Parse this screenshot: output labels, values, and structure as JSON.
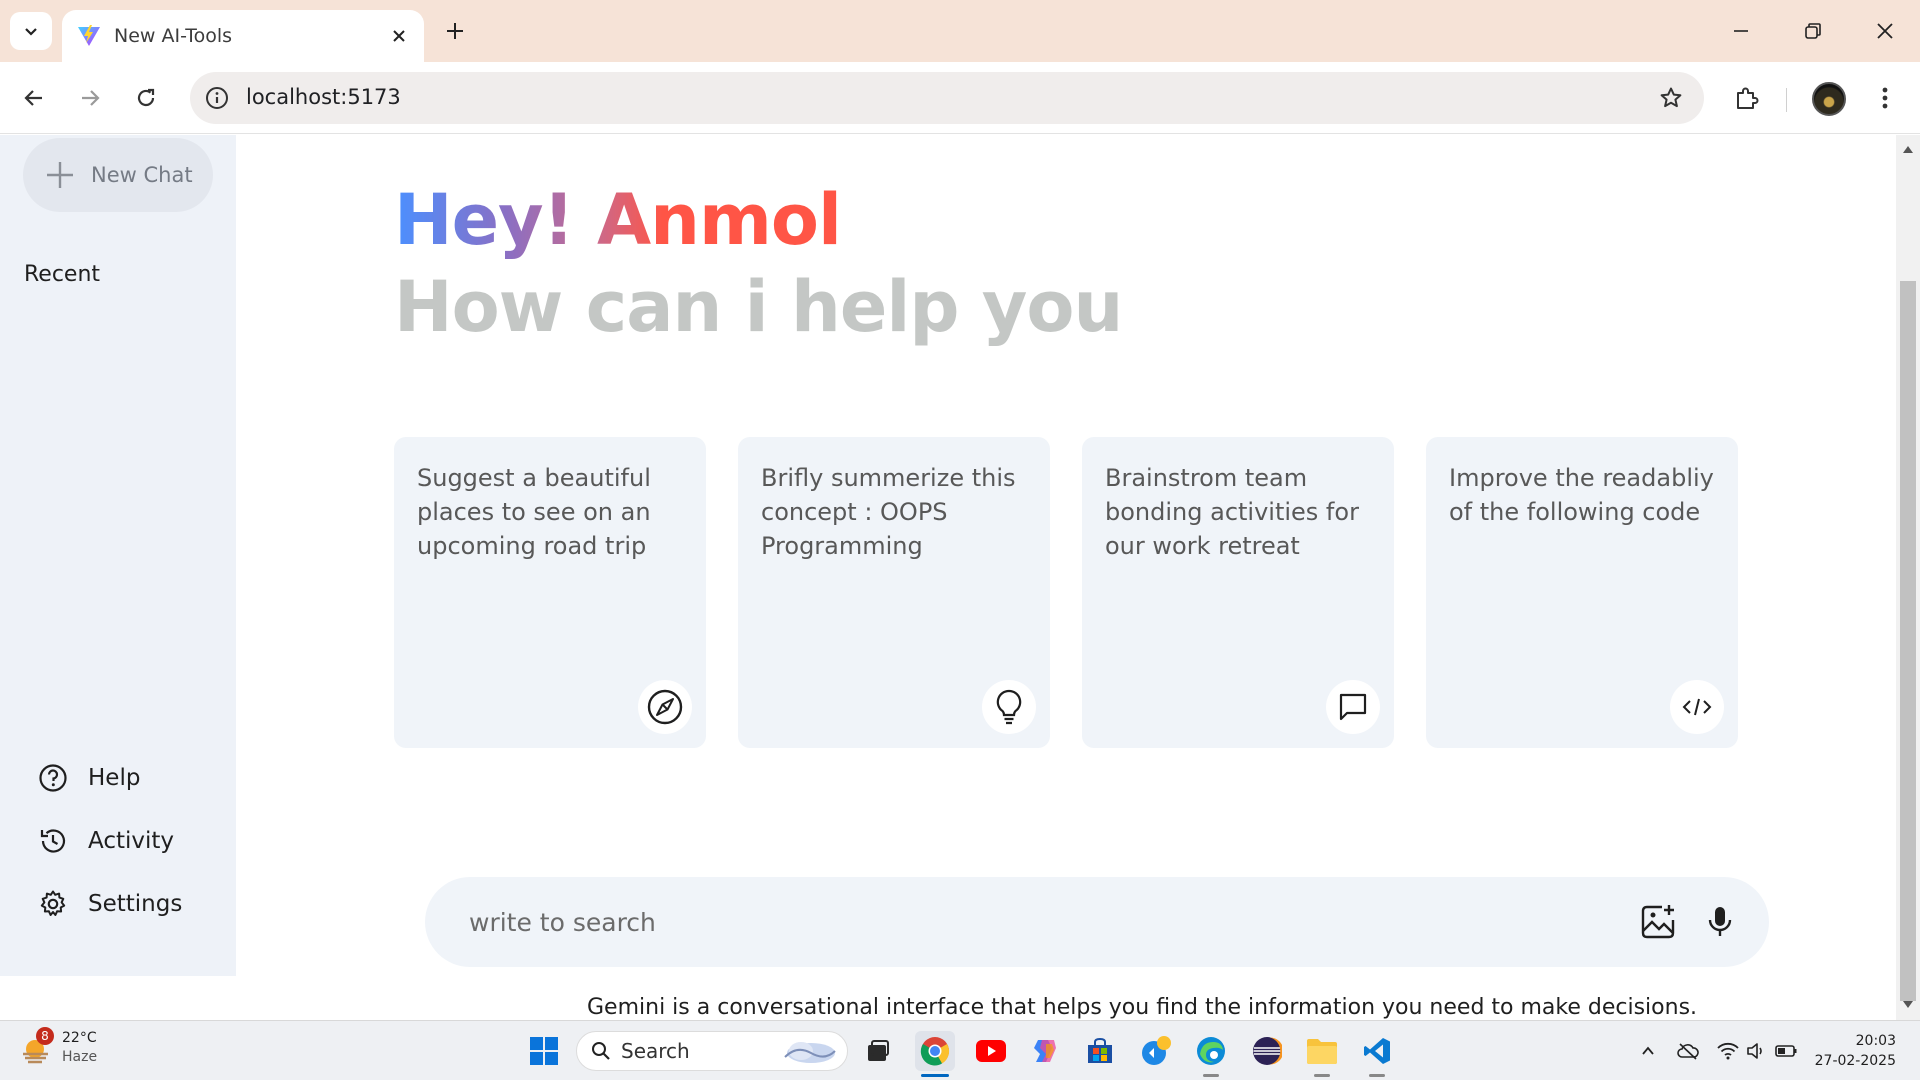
{
  "browser": {
    "tab_title": "New AI-Tools",
    "url": "localhost:5173",
    "icons": {
      "tab_list": "chevron-down-icon",
      "favicon": "vite-logo-icon",
      "close_tab": "close-icon",
      "new_tab": "plus-icon",
      "back": "arrow-left-icon",
      "forward": "arrow-right-icon",
      "reload": "reload-icon",
      "site_info": "info-icon",
      "bookmark": "star-icon",
      "extensions": "puzzle-icon",
      "menu": "kebab-menu-icon"
    }
  },
  "sidebar": {
    "new_chat_label": "New Chat",
    "recent_label": "Recent",
    "bottom_items": [
      {
        "label": "Help",
        "icon": "question-circle-icon"
      },
      {
        "label": "Activity",
        "icon": "history-icon"
      },
      {
        "label": "Settings",
        "icon": "gear-icon"
      }
    ]
  },
  "main": {
    "greeting_name": "Hey! Anmol",
    "subtitle": "How can i help you",
    "cards": [
      {
        "text": "Suggest a beautiful places to see on an upcoming road trip",
        "icon": "compass-icon"
      },
      {
        "text": "Brifly summerize this concept : OOPS Programming",
        "icon": "lightbulb-icon"
      },
      {
        "text": "Brainstrom team bonding activities for our work retreat",
        "icon": "message-icon"
      },
      {
        "text": "Improve the readabliy of the following code",
        "icon": "code-icon"
      }
    ],
    "search_placeholder": "write to search",
    "disclaimer": "Gemini is a conversational interface that helps you find the information you need to make decisions."
  },
  "taskbar": {
    "weather_temp": "22°C",
    "weather_condition": "Haze",
    "weather_badge": "8",
    "search_label": "Search",
    "time": "20:03",
    "date": "27-02-2025",
    "colors": {
      "accent": "#0067c0"
    }
  },
  "colors": {
    "sidebar_bg": "#eef2f8",
    "card_bg": "#f0f4f9",
    "greeting_gradient_start": "#4b90ff",
    "greeting_gradient_end": "#ff5546",
    "subtitle": "#c4c7c5"
  }
}
